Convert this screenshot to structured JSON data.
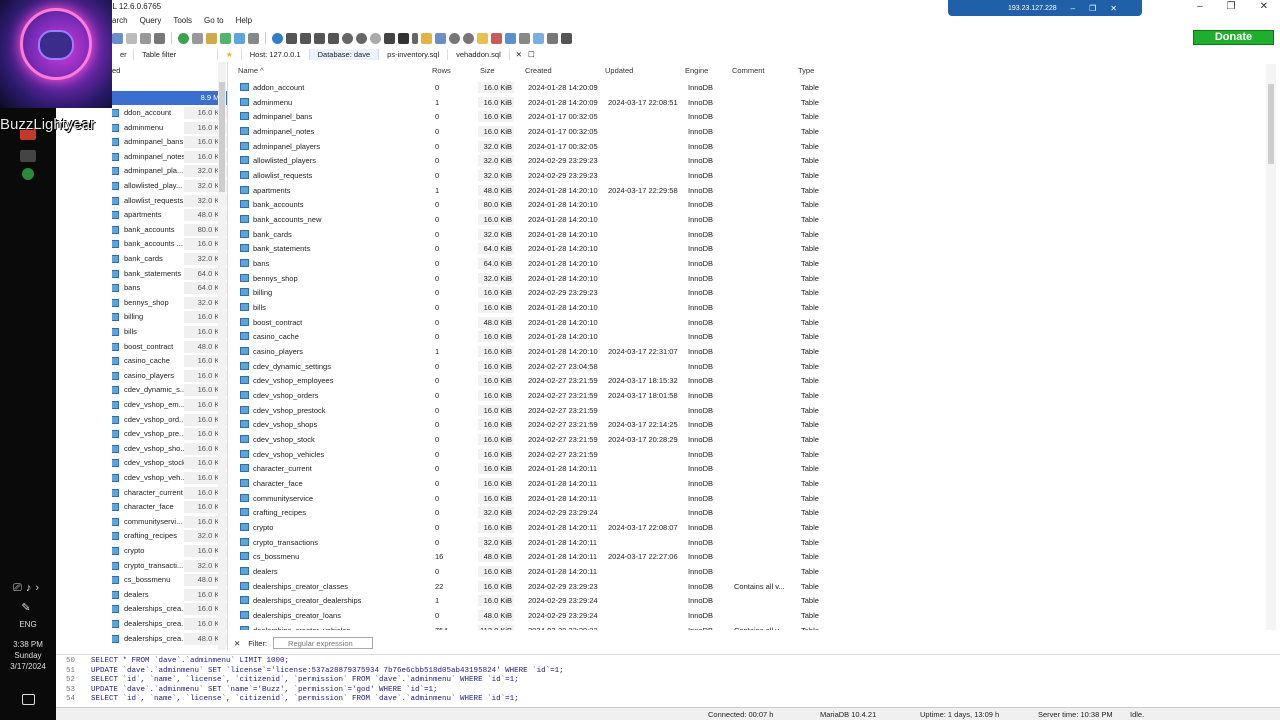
{
  "window": {
    "title": "dave\\ - HeidiSQL 12.6.0.6765",
    "remote_ip": "193.23.127.228"
  },
  "overlay": {
    "streamer_name": "BuzzLightyear"
  },
  "menu": [
    "arch",
    "Query",
    "Tools",
    "Go to",
    "Help"
  ],
  "donate_label": "Donate",
  "tabs": {
    "filter_left": "er",
    "table_filter": "Table filter",
    "host": "Host: 127.0.0.1",
    "database": "Database: dave",
    "file1": "ps-inventory.sql",
    "file2": "vehaddon.sql"
  },
  "tree": {
    "root_label": "ed",
    "root_size": "8.9 MiB",
    "items": [
      {
        "name": "ddon_account",
        "size": "16.0 KiB"
      },
      {
        "name": "adminmenu",
        "size": "16.0 KiB"
      },
      {
        "name": "adminpanel_bans",
        "size": "16.0 KiB"
      },
      {
        "name": "adminpanel_notes",
        "size": "16.0 KiB"
      },
      {
        "name": "adminpanel_pla...",
        "size": "32.0 KiB"
      },
      {
        "name": "allowlisted_play...",
        "size": "32.0 KiB"
      },
      {
        "name": "allowlist_requests",
        "size": "32.0 KiB"
      },
      {
        "name": "apartments",
        "size": "48.0 KiB"
      },
      {
        "name": "bank_accounts",
        "size": "80.0 KiB"
      },
      {
        "name": "bank_accounts ...",
        "size": "16.0 KiB"
      },
      {
        "name": "bank_cards",
        "size": "32.0 KiB"
      },
      {
        "name": "bank_statements",
        "size": "64.0 KiB"
      },
      {
        "name": "bans",
        "size": "64.0 KiB"
      },
      {
        "name": "bennys_shop",
        "size": "32.0 KiB"
      },
      {
        "name": "billing",
        "size": "16.0 KiB"
      },
      {
        "name": "bills",
        "size": "16.0 KiB"
      },
      {
        "name": "boost_contract",
        "size": "48.0 KiB"
      },
      {
        "name": "casino_cache",
        "size": "16.0 KiB"
      },
      {
        "name": "casino_players",
        "size": "16.0 KiB"
      },
      {
        "name": "cdev_dynamic_s...",
        "size": "16.0 KiB"
      },
      {
        "name": "cdev_vshop_em...",
        "size": "16.0 KiB"
      },
      {
        "name": "cdev_vshop_ord...",
        "size": "16.0 KiB"
      },
      {
        "name": "cdev_vshop_pre...",
        "size": "16.0 KiB"
      },
      {
        "name": "cdev_vshop_sho...",
        "size": "16.0 KiB"
      },
      {
        "name": "cdev_vshop_stock",
        "size": "16.0 KiB"
      },
      {
        "name": "cdev_vshop_veh...",
        "size": "16.0 KiB"
      },
      {
        "name": "character_current",
        "size": "16.0 KiB"
      },
      {
        "name": "character_face",
        "size": "16.0 KiB"
      },
      {
        "name": "communityservi...",
        "size": "16.0 KiB"
      },
      {
        "name": "crafting_recipes",
        "size": "32.0 KiB"
      },
      {
        "name": "crypto",
        "size": "16.0 KiB"
      },
      {
        "name": "crypto_transacti...",
        "size": "32.0 KiB"
      },
      {
        "name": "cs_bossmenu",
        "size": "48.0 KiB"
      },
      {
        "name": "dealers",
        "size": "16.0 KiB"
      },
      {
        "name": "dealerships_crea...",
        "size": "16.0 KiB"
      },
      {
        "name": "dealerships_crea...",
        "size": "16.0 KiB"
      },
      {
        "name": "dealerships_crea...",
        "size": "48.0 KiB"
      }
    ]
  },
  "grid": {
    "headers": [
      "Name",
      "Rows",
      "Size",
      "Created",
      "Updated",
      "Engine",
      "Comment",
      "Type"
    ],
    "rows": [
      [
        "addon_account",
        "0",
        "16.0 KiB",
        "2024-01-28 14:20:09",
        "",
        "InnoDB",
        "",
        "Table"
      ],
      [
        "adminmenu",
        "1",
        "16.0 KiB",
        "2024-01-28 14:20:09",
        "2024-03-17 22:08:51",
        "InnoDB",
        "",
        "Table"
      ],
      [
        "adminpanel_bans",
        "0",
        "16.0 KiB",
        "2024-01-17 00:32:05",
        "",
        "InnoDB",
        "",
        "Table"
      ],
      [
        "adminpanel_notes",
        "0",
        "16.0 KiB",
        "2024-01-17 00:32:05",
        "",
        "InnoDB",
        "",
        "Table"
      ],
      [
        "adminpanel_players",
        "0",
        "32.0 KiB",
        "2024-01-17 00:32:05",
        "",
        "InnoDB",
        "",
        "Table"
      ],
      [
        "allowlisted_players",
        "0",
        "32.0 KiB",
        "2024-02-29 23:29:23",
        "",
        "InnoDB",
        "",
        "Table"
      ],
      [
        "allowlist_requests",
        "0",
        "32.0 KiB",
        "2024-02-29 23:29:23",
        "",
        "InnoDB",
        "",
        "Table"
      ],
      [
        "apartments",
        "1",
        "48.0 KiB",
        "2024-01-28 14:20:10",
        "2024-03-17 22:29:58",
        "InnoDB",
        "",
        "Table"
      ],
      [
        "bank_accounts",
        "0",
        "80.0 KiB",
        "2024-01-28 14:20:10",
        "",
        "InnoDB",
        "",
        "Table"
      ],
      [
        "bank_accounts_new",
        "0",
        "16.0 KiB",
        "2024-01-28 14:20:10",
        "",
        "InnoDB",
        "",
        "Table"
      ],
      [
        "bank_cards",
        "0",
        "32.0 KiB",
        "2024-01-28 14:20:10",
        "",
        "InnoDB",
        "",
        "Table"
      ],
      [
        "bank_statements",
        "0",
        "64.0 KiB",
        "2024-01-28 14:20:10",
        "",
        "InnoDB",
        "",
        "Table"
      ],
      [
        "bans",
        "0",
        "64.0 KiB",
        "2024-01-28 14:20:10",
        "",
        "InnoDB",
        "",
        "Table"
      ],
      [
        "bennys_shop",
        "0",
        "32.0 KiB",
        "2024-01-28 14:20:10",
        "",
        "InnoDB",
        "",
        "Table"
      ],
      [
        "billing",
        "0",
        "16.0 KiB",
        "2024-02-29 23:29:23",
        "",
        "InnoDB",
        "",
        "Table"
      ],
      [
        "bills",
        "0",
        "16.0 KiB",
        "2024-01-28 14:20:10",
        "",
        "InnoDB",
        "",
        "Table"
      ],
      [
        "boost_contract",
        "0",
        "48.0 KiB",
        "2024-01-28 14:20:10",
        "",
        "InnoDB",
        "",
        "Table"
      ],
      [
        "casino_cache",
        "0",
        "16.0 KiB",
        "2024-01-28 14:20:10",
        "",
        "InnoDB",
        "",
        "Table"
      ],
      [
        "casino_players",
        "1",
        "16.0 KiB",
        "2024-01-28 14:20:10",
        "2024-03-17 22:31:07",
        "InnoDB",
        "",
        "Table"
      ],
      [
        "cdev_dynamic_settings",
        "0",
        "16.0 KiB",
        "2024-02-27 23:04:58",
        "",
        "InnoDB",
        "",
        "Table"
      ],
      [
        "cdev_vshop_employees",
        "0",
        "16.0 KiB",
        "2024-02-27 23:21:59",
        "2024-03-17 18:15:32",
        "InnoDB",
        "",
        "Table"
      ],
      [
        "cdev_vshop_orders",
        "0",
        "16.0 KiB",
        "2024-02-27 23:21:59",
        "2024-03-17 18:01:58",
        "InnoDB",
        "",
        "Table"
      ],
      [
        "cdev_vshop_prestock",
        "0",
        "16.0 KiB",
        "2024-02-27 23:21:59",
        "",
        "InnoDB",
        "",
        "Table"
      ],
      [
        "cdev_vshop_shops",
        "0",
        "16.0 KiB",
        "2024-02-27 23:21:59",
        "2024-03-17 22:14:25",
        "InnoDB",
        "",
        "Table"
      ],
      [
        "cdev_vshop_stock",
        "0",
        "16.0 KiB",
        "2024-02-27 23:21:59",
        "2024-03-17 20:28:29",
        "InnoDB",
        "",
        "Table"
      ],
      [
        "cdev_vshop_vehicles",
        "0",
        "16.0 KiB",
        "2024-02-27 23:21:59",
        "",
        "InnoDB",
        "",
        "Table"
      ],
      [
        "character_current",
        "0",
        "16.0 KiB",
        "2024-01-28 14:20:11",
        "",
        "InnoDB",
        "",
        "Table"
      ],
      [
        "character_face",
        "0",
        "16.0 KiB",
        "2024-01-28 14:20:11",
        "",
        "InnoDB",
        "",
        "Table"
      ],
      [
        "communityservice",
        "0",
        "16.0 KiB",
        "2024-01-28 14:20:11",
        "",
        "InnoDB",
        "",
        "Table"
      ],
      [
        "crafting_recipes",
        "0",
        "32.0 KiB",
        "2024-02-29 23:29:24",
        "",
        "InnoDB",
        "",
        "Table"
      ],
      [
        "crypto",
        "0",
        "16.0 KiB",
        "2024-01-28 14:20:11",
        "2024-03-17 22:08:07",
        "InnoDB",
        "",
        "Table"
      ],
      [
        "crypto_transactions",
        "0",
        "32.0 KiB",
        "2024-01-28 14:20:11",
        "",
        "InnoDB",
        "",
        "Table"
      ],
      [
        "cs_bossmenu",
        "16",
        "48.0 KiB",
        "2024-01-28 14:20:11",
        "2024-03-17 22:27:06",
        "InnoDB",
        "",
        "Table"
      ],
      [
        "dealers",
        "0",
        "16.0 KiB",
        "2024-01-28 14:20:11",
        "",
        "InnoDB",
        "",
        "Table"
      ],
      [
        "dealerships_creator_classes",
        "22",
        "16.0 KiB",
        "2024-02-29 23:29:23",
        "",
        "InnoDB",
        "Contains all v...",
        "Table"
      ],
      [
        "dealerships_creator_dealerships",
        "1",
        "16.0 KiB",
        "2024-02-29 23:29:24",
        "",
        "InnoDB",
        "",
        "Table"
      ],
      [
        "dealerships_creator_loans",
        "0",
        "48.0 KiB",
        "2024-02-29 23:29:24",
        "",
        "InnoDB",
        "",
        "Table"
      ],
      [
        "dealerships_creator_vehicles",
        "754",
        "112.0 KiB",
        "2024-02-29 23:29:23",
        "",
        "InnoDB",
        "Contains all v...",
        "Table"
      ]
    ]
  },
  "filter": {
    "label": "Filter:",
    "placeholder": "Regular expression"
  },
  "sql_log": [
    {
      "n": "50",
      "text": "SELECT * FROM `dave`.`adminmenu` LIMIT 1000;"
    },
    {
      "n": "51",
      "text": "UPDATE `dave`.`adminmenu` SET `license`='license:537a28879375934 7b76e6cbb518d05ab43195824' WHERE `id`=1;"
    },
    {
      "n": "52",
      "text": "SELECT `id`, `name`, `license`, `citizenid`, `permission` FROM `dave`.`adminmenu` WHERE `id`=1;"
    },
    {
      "n": "53",
      "text": "UPDATE `dave`.`adminmenu` SET `name`='Buzz', `permission`='god' WHERE `id`=1;"
    },
    {
      "n": "54",
      "text": "SELECT `id`, `name`, `license`, `citizenid`, `permission` FROM `dave`.`adminmenu` WHERE `id`=1;"
    }
  ],
  "status": {
    "connected": "Connected: 00:07 h",
    "server": "MariaDB 10.4.21",
    "uptime": "Uptime: 1 days, 13:09 h",
    "server_time": "Server time: 10:38 PM",
    "state": "Idle."
  },
  "system_tray": {
    "lang": "ENG",
    "time": "3:38 PM",
    "day": "Sunday",
    "date": "3/17/2024"
  },
  "colors": {
    "donate": "#1fae2d",
    "remote_bar": "#2060a8",
    "table_icon": "#5fa3dd"
  }
}
